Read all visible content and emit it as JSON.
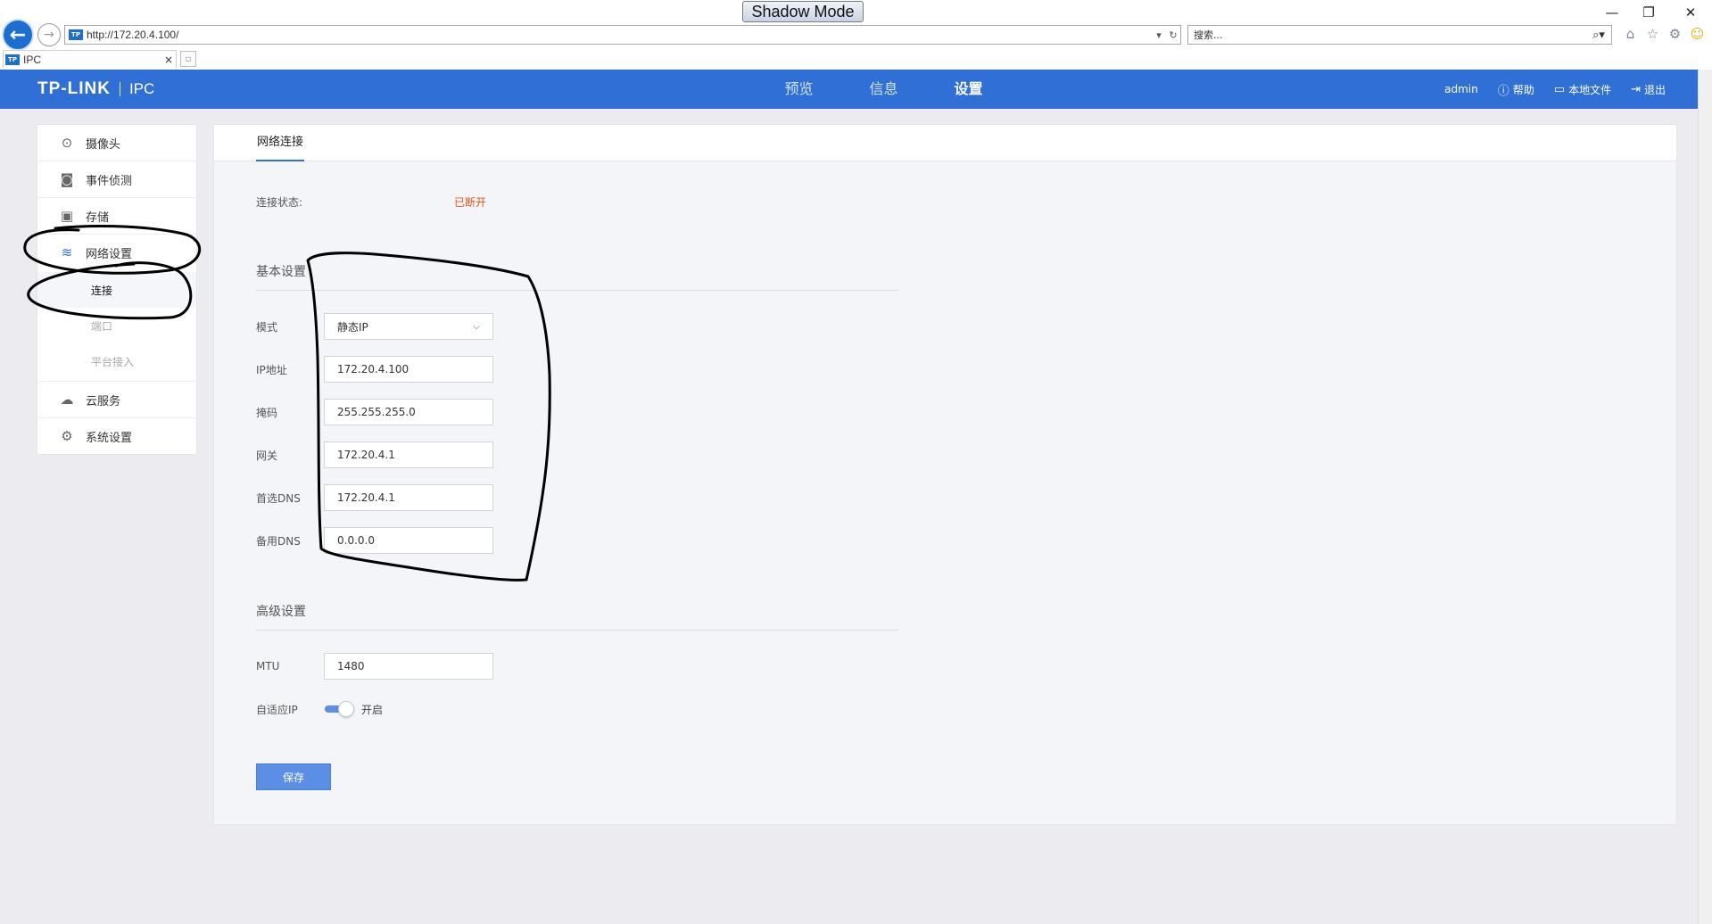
{
  "browser": {
    "shadow_mode_label": "Shadow Mode",
    "address_url": "http://172.20.4.100/",
    "search_placeholder": "搜索...",
    "tab_title": "IPC",
    "tab_close": "×",
    "favicon_text": "TP",
    "window_controls": {
      "minimize": "—",
      "restore": "❐",
      "close": "✕"
    }
  },
  "header": {
    "logo_main": "TP-LINK",
    "logo_sub": "IPC",
    "nav": [
      {
        "label": "预览",
        "active": false
      },
      {
        "label": "信息",
        "active": false
      },
      {
        "label": "设置",
        "active": true
      }
    ],
    "user": "admin",
    "help": "帮助",
    "local_files": "本地文件",
    "logout": "退出"
  },
  "sidebar": {
    "camera": "摄像头",
    "event_detection": "事件侦测",
    "storage": "存储",
    "network_settings": "网络设置",
    "sub_connection": "连接",
    "sub_port": "端口",
    "sub_platform": "平台接入",
    "cloud_service": "云服务",
    "system_settings": "系统设置"
  },
  "content": {
    "tab": "网络连接",
    "status_label": "连接状态:",
    "status_value": "已断开",
    "basic_title": "基本设置",
    "mode_label": "模式",
    "mode_value": "静态IP",
    "ip_label": "IP地址",
    "ip_value": "172.20.4.100",
    "mask_label": "掩码",
    "mask_value": "255.255.255.0",
    "gateway_label": "网关",
    "gateway_value": "172.20.4.1",
    "dns1_label": "首选DNS",
    "dns1_value": "172.20.4.1",
    "dns2_label": "备用DNS",
    "dns2_value": "0.0.0.0",
    "advanced_title": "高级设置",
    "mtu_label": "MTU",
    "mtu_value": "1480",
    "adaptive_ip_label": "自适应IP",
    "adaptive_ip_state": "开启",
    "adaptive_ip_on": true,
    "save_label": "保存"
  },
  "colors": {
    "brand_blue": "#2f6fd6",
    "status_disconnected": "#e05a1a",
    "button_blue": "#5b8fe6"
  }
}
